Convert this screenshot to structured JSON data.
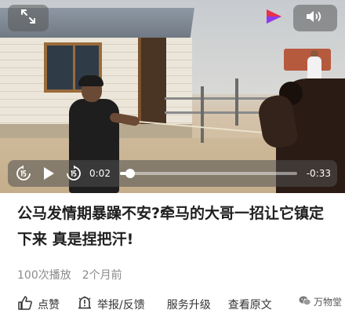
{
  "video": {
    "current_time": "0:02",
    "remaining_time": "-0:33",
    "progress_fraction": 0.06
  },
  "post": {
    "title": "公马发情期暴躁不安?牵马的大哥一招让它镇定下来 真是捏把汗!",
    "plays": "100次播放",
    "posted": "2个月前"
  },
  "actions": {
    "like": "点赞",
    "report": "举报/反馈",
    "upgrade": "服务升级",
    "original": "查看原文"
  },
  "watermark": {
    "text": "万物堂"
  },
  "icons": {
    "fullscreen": "fullscreen-expand-icon",
    "volume": "speaker-volume-icon",
    "rewind": "rewind-15-icon",
    "play": "play-icon",
    "forward": "forward-15-icon",
    "brand": "brand-logo-icon",
    "like": "thumbs-up-icon",
    "report": "report-bell-icon",
    "wechat": "wechat-icon"
  },
  "colors": {
    "brand_red": "#e8304a",
    "brand_purple": "#8a3cf0",
    "overlay": "#5a5a5a"
  }
}
